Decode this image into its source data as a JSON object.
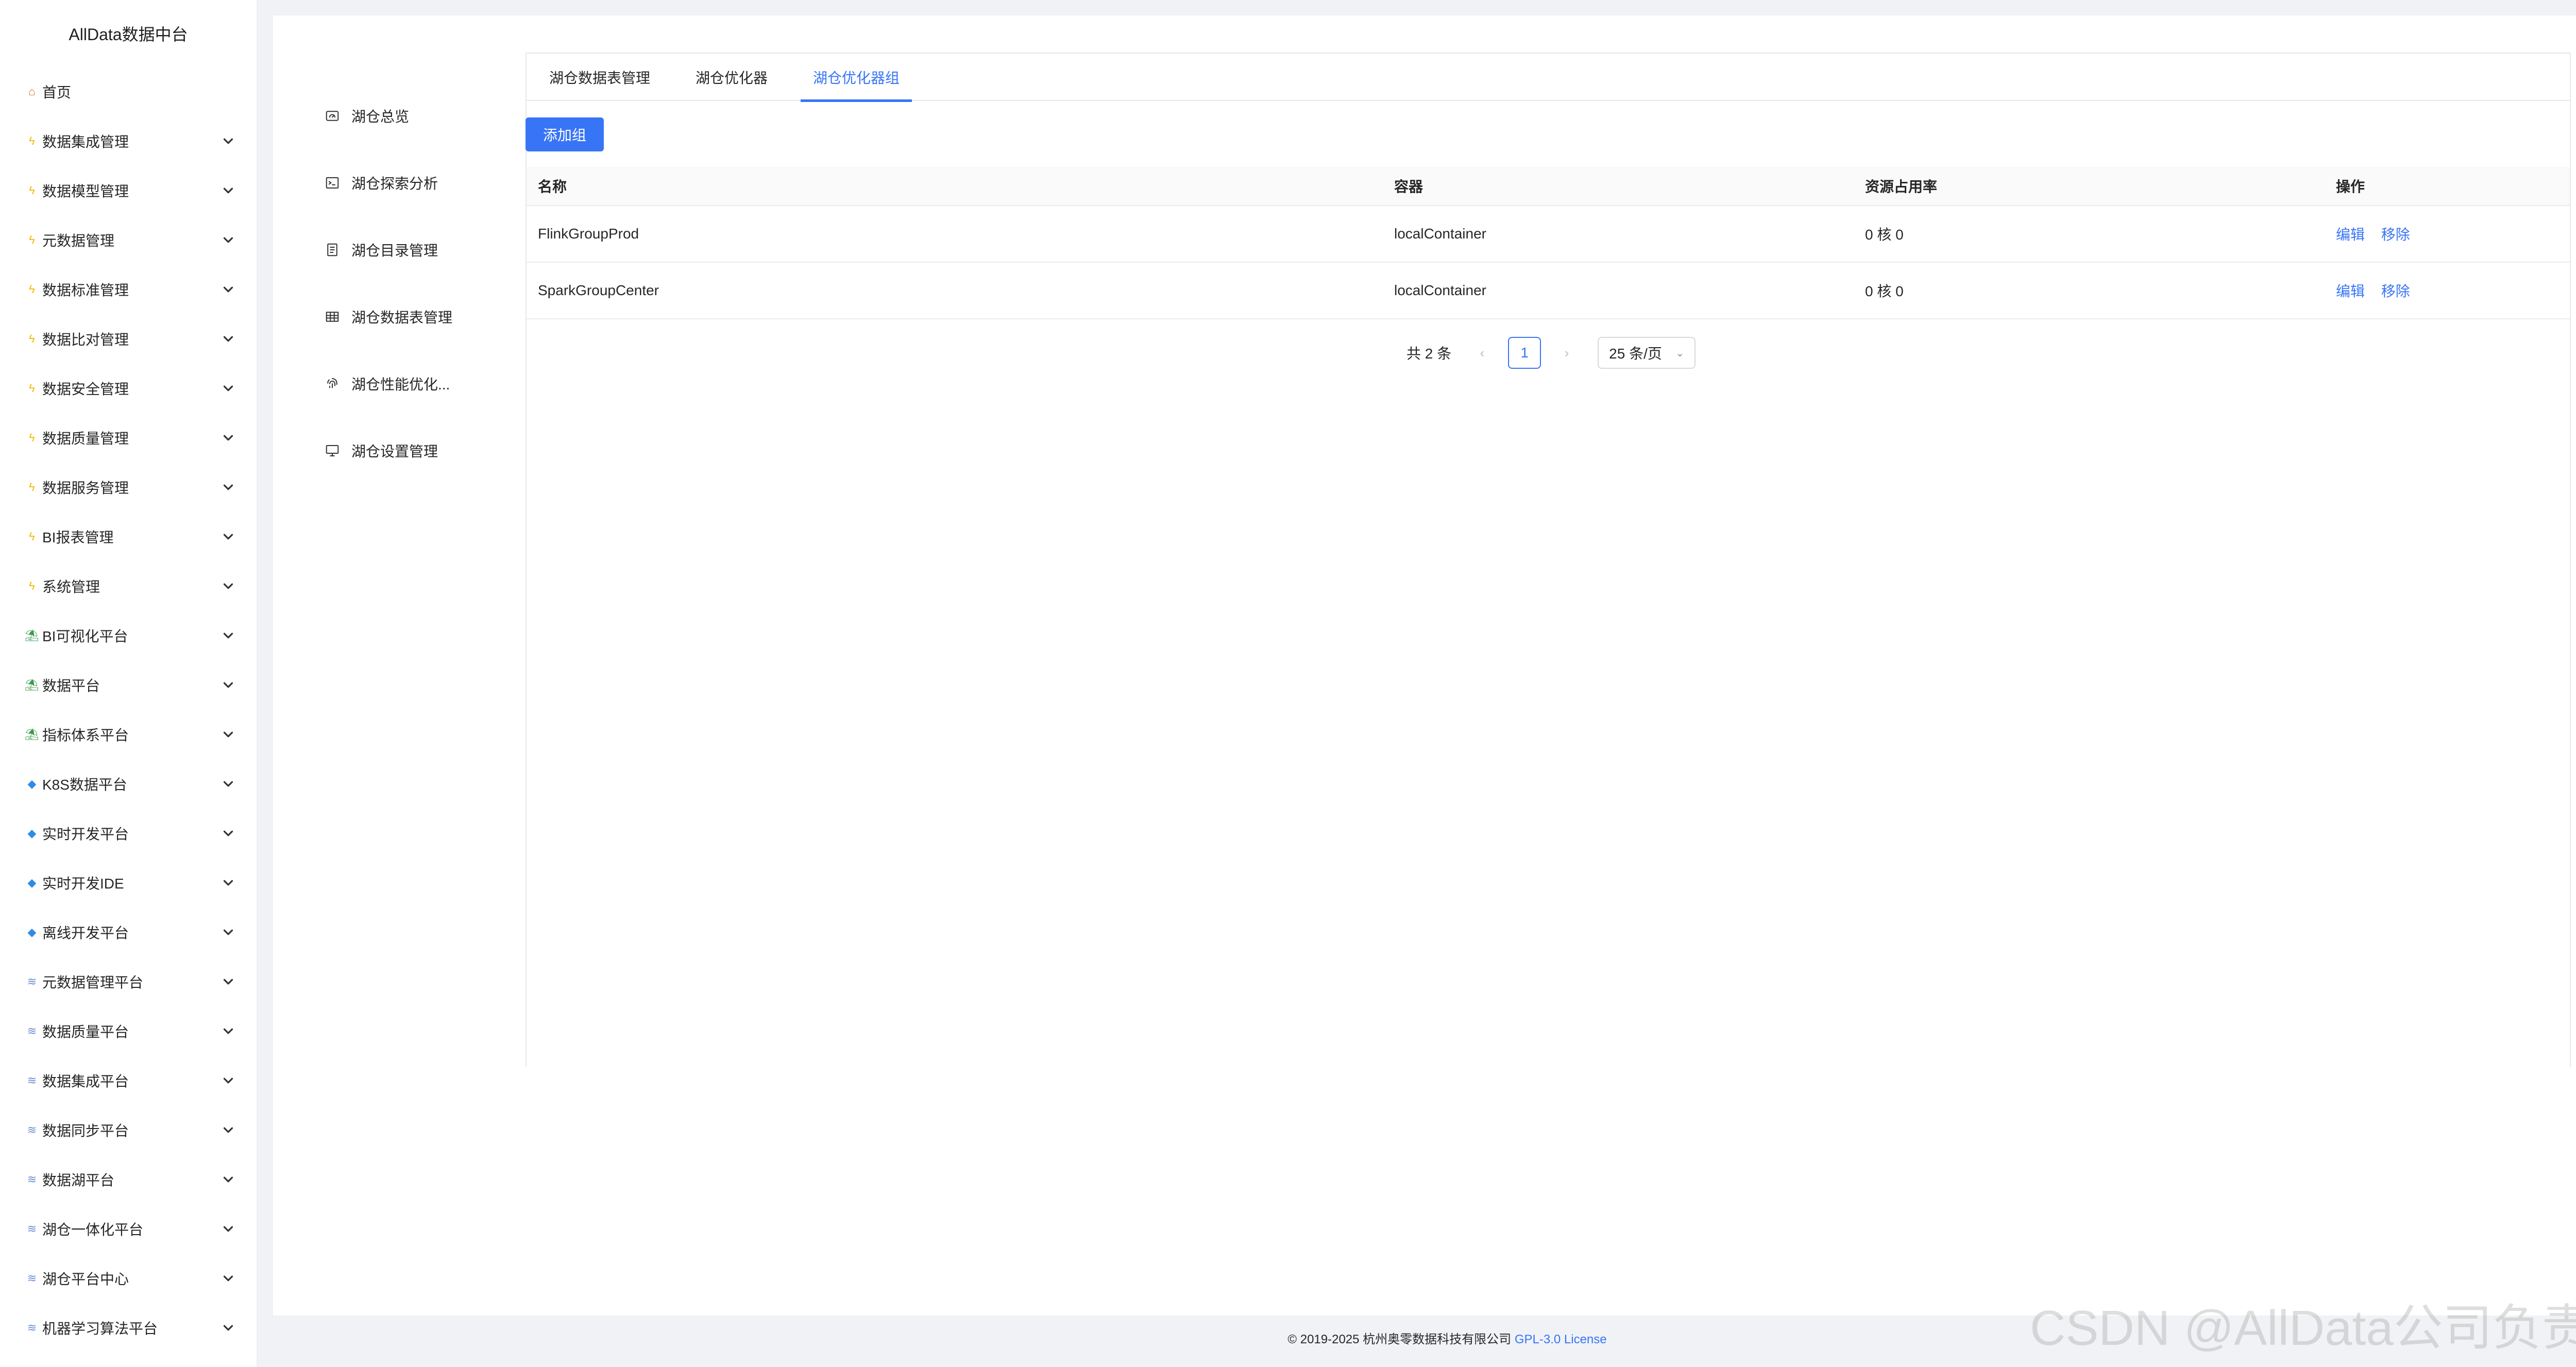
{
  "app": {
    "title": "AllData数据中台"
  },
  "sidebar": {
    "items": [
      {
        "label": "首页",
        "icon": "home-icon",
        "kind": "home",
        "expandable": false
      },
      {
        "label": "数据集成管理",
        "icon": "bolt-icon",
        "kind": "bolt",
        "expandable": true
      },
      {
        "label": "数据模型管理",
        "icon": "bolt-icon",
        "kind": "bolt",
        "expandable": true
      },
      {
        "label": "元数据管理",
        "icon": "bolt-icon",
        "kind": "bolt",
        "expandable": true
      },
      {
        "label": "数据标准管理",
        "icon": "bolt-icon",
        "kind": "bolt",
        "expandable": true
      },
      {
        "label": "数据比对管理",
        "icon": "bolt-icon",
        "kind": "bolt",
        "expandable": true
      },
      {
        "label": "数据安全管理",
        "icon": "bolt-icon",
        "kind": "bolt",
        "expandable": true
      },
      {
        "label": "数据质量管理",
        "icon": "bolt-icon",
        "kind": "bolt",
        "expandable": true
      },
      {
        "label": "数据服务管理",
        "icon": "bolt-icon",
        "kind": "bolt",
        "expandable": true
      },
      {
        "label": "BI报表管理",
        "icon": "bolt-icon",
        "kind": "bolt",
        "expandable": true
      },
      {
        "label": "系统管理",
        "icon": "bolt-icon",
        "kind": "bolt",
        "expandable": true
      },
      {
        "label": "BI可视化平台",
        "icon": "platform-icon",
        "kind": "plat",
        "expandable": true
      },
      {
        "label": "数据平台",
        "icon": "platform-icon",
        "kind": "plat",
        "expandable": true
      },
      {
        "label": "指标体系平台",
        "icon": "platform-icon",
        "kind": "plat",
        "expandable": true
      },
      {
        "label": "K8S数据平台",
        "icon": "gem-icon",
        "kind": "gem",
        "expandable": true
      },
      {
        "label": "实时开发平台",
        "icon": "gem-icon",
        "kind": "gem",
        "expandable": true
      },
      {
        "label": "实时开发IDE",
        "icon": "gem-icon",
        "kind": "gem",
        "expandable": true
      },
      {
        "label": "离线开发平台",
        "icon": "gem-icon",
        "kind": "gem",
        "expandable": true
      },
      {
        "label": "元数据管理平台",
        "icon": "stack-icon",
        "kind": "stack",
        "expandable": true
      },
      {
        "label": "数据质量平台",
        "icon": "stack-icon",
        "kind": "stack",
        "expandable": true
      },
      {
        "label": "数据集成平台",
        "icon": "stack-icon",
        "kind": "stack",
        "expandable": true
      },
      {
        "label": "数据同步平台",
        "icon": "stack-icon",
        "kind": "stack",
        "expandable": true
      },
      {
        "label": "数据湖平台",
        "icon": "stack-icon",
        "kind": "stack",
        "expandable": true
      },
      {
        "label": "湖仓一体化平台",
        "icon": "stack-icon",
        "kind": "stack",
        "expandable": true
      },
      {
        "label": "湖仓平台中心",
        "icon": "stack-icon",
        "kind": "stack",
        "expandable": true
      },
      {
        "label": "机器学习算法平台",
        "icon": "stack-icon",
        "kind": "stack",
        "expandable": true
      }
    ]
  },
  "subnav": {
    "items": [
      {
        "label": "湖仓总览",
        "icon": "dashboard-icon"
      },
      {
        "label": "湖仓探索分析",
        "icon": "terminal-icon"
      },
      {
        "label": "湖仓目录管理",
        "icon": "catalog-icon"
      },
      {
        "label": "湖仓数据表管理",
        "icon": "table-icon"
      },
      {
        "label": "湖仓性能优化...",
        "icon": "fingerprint-icon"
      },
      {
        "label": "湖仓设置管理",
        "icon": "monitor-icon"
      }
    ]
  },
  "tabs": [
    {
      "label": "湖仓数据表管理",
      "active": false
    },
    {
      "label": "湖仓优化器",
      "active": false
    },
    {
      "label": "湖仓优化器组",
      "active": true
    }
  ],
  "toolbar": {
    "add_label": "添加组"
  },
  "table": {
    "headers": [
      "名称",
      "容器",
      "资源占用率",
      "操作"
    ],
    "rows": [
      {
        "name": "FlinkGroupProd",
        "container": "localContainer",
        "usage": "0 核 0",
        "edit": "编辑",
        "remove": "移除"
      },
      {
        "name": "SparkGroupCenter",
        "container": "localContainer",
        "usage": "0 核 0",
        "edit": "编辑",
        "remove": "移除"
      }
    ]
  },
  "pagination": {
    "total_label": "共 2 条",
    "prev": "‹",
    "current_page": "1",
    "next": "›",
    "page_size": "25 条/页"
  },
  "footer": {
    "copyright": "© 2019-2025 杭州奥零数据科技有限公司",
    "license": "GPL-3.0 License"
  },
  "watermark": "CSDN @AllData公司负责人",
  "colors": {
    "accent": "#3875f6",
    "background": "#f0f2f5"
  }
}
